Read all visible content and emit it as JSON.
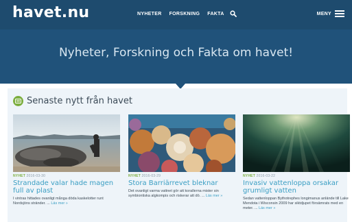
{
  "header": {
    "logo": "havet.nu",
    "nav": [
      {
        "label": "NYHETER"
      },
      {
        "label": "FORSKNING"
      },
      {
        "label": "FAKTA"
      }
    ],
    "menu_label": "MENY"
  },
  "hero": {
    "title": "Nyheter, Forskning och Fakta om havet!"
  },
  "section": {
    "title": "Senaste nytt från havet"
  },
  "cards": [
    {
      "category": "NYHET",
      "date": "2016-03-30",
      "title": "Strandade valar hade magen full av plast",
      "text": "I vintras hittades ovanligt många döda kaskelotter runt Nordsjöns stränder. ...",
      "more": "Läs mer »"
    },
    {
      "category": "NYHET",
      "date": "2016-03-29",
      "title": "Stora Barriärrevet bleknar",
      "text": "Det ovanligt varma vattnet gör att korallerna mister sin symbiontiska algkompis och riskerar att dö. ...",
      "more": "Läs mer »"
    },
    {
      "category": "NYHET",
      "date": "2016-03-22",
      "title": "Invasiv vattenloppa orsakar grumligt vatten",
      "text": "Sedan vattenloppan Bythotrephes longimanus anlände till Lake Mendota i Wisconsin 2009 har siktdjupet försämrats med en meter. ...",
      "more": "Läs mer »"
    }
  ]
}
